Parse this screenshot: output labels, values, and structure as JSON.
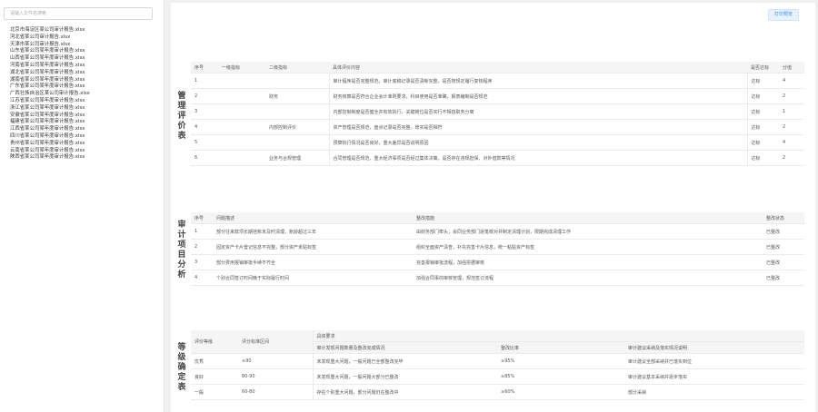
{
  "sidebar": {
    "search_placeholder": "请输入文件名搜索",
    "files": [
      "北京市海淀区某公司审计报告.xlsx",
      "河北省某公司审计报告.xlsx",
      "天津市某公司审计报告.xlsx",
      "山东省某公司某年度审计报告.xlsx",
      "山西省某公司某年度审计报告.xlsx",
      "河南省某公司某年度审计报告.xlsx",
      "湖北省某公司某年度审计报告.xlsx",
      "湖南省某公司某年度审计报告.xlsx",
      "广东省某公司某年度审计报告.xlsx",
      "广西壮族自治区某公司审计报告.xlsx",
      "江苏省某公司某年度审计报告.xlsx",
      "浙江省某公司某年度审计报告.xlsx",
      "安徽省某公司某年度审计报告.xlsx",
      "福建省某公司某年度审计报告.xlsx",
      "江西省某公司某年度审计报告.xlsx",
      "四川省某公司某年度审计报告.xlsx",
      "贵州省某公司某年度审计报告.xlsx",
      "云南省某公司某年度审计报告.xlsx",
      "陕西省某公司某年度审计报告.xlsx"
    ]
  },
  "toolbar": {
    "export_label": "打印预览"
  },
  "section1": {
    "title": "管理评价表",
    "headers": [
      "序号",
      "一级指标",
      "二级指标",
      "具体评价内容",
      "是否达标",
      "分值"
    ],
    "rows": [
      [
        "1",
        "",
        "",
        "审计程序是否完整规范，审计底稿记录是否清晰完整，是否按规定履行复核程序",
        "达标",
        "4"
      ],
      [
        "2",
        "",
        "财务",
        "财务核算是否符合企业会计准则要求，科目使用是否准确，报表编制是否规范",
        "达标",
        "2"
      ],
      [
        "3",
        "",
        "",
        "内部控制制度是否健全并有效执行，关键岗位是否实行不相容职务分离",
        "达标",
        "1"
      ],
      [
        "4",
        "",
        "内部控制评价",
        "资产管理是否规范，盘点记录是否完整，账实是否相符",
        "达标",
        "2"
      ],
      [
        "5",
        "",
        "",
        "预算执行情况是否良好，重大差异是否说明原因",
        "达标",
        "4"
      ],
      [
        "6",
        "",
        "业务与合规管理",
        "合同管理是否规范，重大经济事项是否经过集体决策，是否存在违规担保、对外借款等情况",
        "达标",
        "2"
      ]
    ]
  },
  "section2": {
    "title": "审计项目分析",
    "headers": [
      "序号",
      "问题描述",
      "整改措施",
      "整改状态"
    ],
    "rows": [
      [
        "1",
        "部分往来款项长期挂账未及时清理，账龄超过三年",
        "由财务部门牵头，会同业务部门逐笔核对并制定清理计划，限期完成清理工作",
        "已整改"
      ],
      [
        "2",
        "固定资产卡片登记信息不完整，部分资产未贴标签",
        "组织全面资产清查，补充完善卡片信息，统一粘贴资产标签",
        "已整改"
      ],
      [
        "3",
        "部分费用报销审批手续不齐全",
        "完善报销审批流程，加强票据审核",
        "已整改"
      ],
      [
        "4",
        "个别合同签订时间晚于实际履行时间",
        "加强合同事前审核管理，规范签订流程",
        "已整改"
      ]
    ]
  },
  "section3": {
    "title": "等级确定表",
    "headers": [
      "评价等级",
      "评分标准区间"
    ],
    "group_header": "具体要求",
    "sub_headers": [
      "审计发现问题数量及整改完成情况",
      "整改比率",
      "审计建议采纳及落实情况说明"
    ],
    "rows": [
      [
        "优秀",
        "≥90",
        "未发现重大问题，一般问题已全部整改完毕",
        "≥95%",
        "审计建议全部采纳并已落实到位"
      ],
      [
        "良好",
        "80-90",
        "未发现重大问题，一般问题大部分已整改",
        "≥85%",
        "审计建议基本采纳并逐步落实"
      ],
      [
        "一般",
        "60-80",
        "存在个别重大问题，部分问题仍在整改中",
        "≥60%",
        "部分采纳"
      ]
    ]
  }
}
